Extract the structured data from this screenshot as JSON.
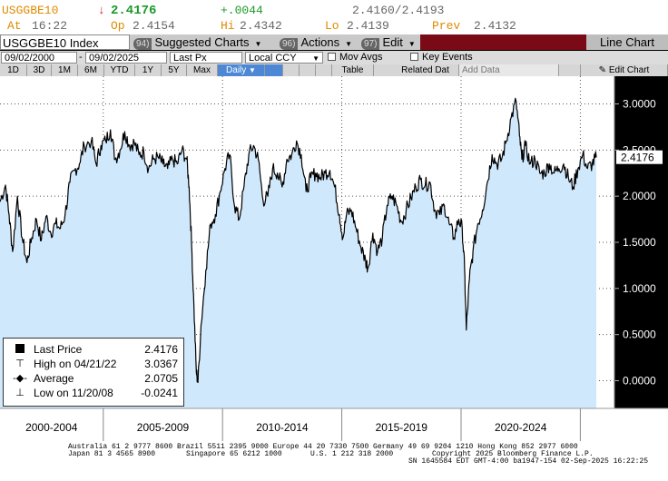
{
  "quote": {
    "ticker": "USGGBE10",
    "arrow": "↓",
    "last": "2.4176",
    "change": "+.0044",
    "bid_ask": "2.4160/2.4193",
    "at_label": "At",
    "at_value": "16:22",
    "open_label": "Op",
    "open_value": "2.4154",
    "high_label": "Hi",
    "high_value": "2.4342",
    "low_label": "Lo",
    "low_value": "2.4139",
    "prev_label": "Prev",
    "prev_value": "2.4132"
  },
  "toolbar": {
    "security": "USGGBE10 Index",
    "suggested_num": "94)",
    "suggested": "Suggested Charts",
    "actions_num": "96)",
    "actions": "Actions",
    "edit_num": "97)",
    "edit": "Edit",
    "chart_type": "Line Chart"
  },
  "controls": {
    "start_date": "09/02/2000",
    "end_date": "09/02/2025",
    "field": "Last Px",
    "currency": "Local CCY",
    "mov_avgs": "Mov Avgs",
    "key_events": "Key Events"
  },
  "periods": [
    "1D",
    "3D",
    "1M",
    "6M",
    "YTD",
    "1Y",
    "5Y",
    "Max"
  ],
  "frequency": "Daily",
  "actions2": {
    "table": "Table",
    "related": "Related Dat",
    "add_data": "Add Data",
    "edit_chart": "Edit Chart"
  },
  "chart_data": {
    "type": "area",
    "series": [
      {
        "name": "USGGBE10 Index"
      }
    ],
    "x_tick_labels": [
      "2000-2004",
      "2005-2009",
      "2010-2014",
      "2015-2019",
      "2020-2024"
    ],
    "y_ticks": [
      "3.0000",
      "2.5000",
      "2.0000",
      "1.5000",
      "1.0000",
      "0.5000",
      "0.0000"
    ],
    "ylim": [
      -0.3,
      3.3
    ],
    "last_value_label": "2.4176",
    "points": [
      [
        2000.67,
        1.94
      ],
      [
        2000.9,
        2.12
      ],
      [
        2001.05,
        1.8
      ],
      [
        2001.2,
        1.4
      ],
      [
        2001.4,
        2.0
      ],
      [
        2001.6,
        1.55
      ],
      [
        2001.8,
        1.28
      ],
      [
        2002.0,
        1.55
      ],
      [
        2002.2,
        1.75
      ],
      [
        2002.4,
        1.52
      ],
      [
        2002.6,
        1.78
      ],
      [
        2002.8,
        1.6
      ],
      [
        2003.0,
        1.7
      ],
      [
        2003.2,
        1.65
      ],
      [
        2003.4,
        1.8
      ],
      [
        2003.6,
        2.15
      ],
      [
        2003.8,
        2.28
      ],
      [
        2004.0,
        2.35
      ],
      [
        2004.2,
        2.55
      ],
      [
        2004.5,
        2.6
      ],
      [
        2004.7,
        2.35
      ],
      [
        2004.9,
        2.55
      ],
      [
        2005.1,
        2.6
      ],
      [
        2005.3,
        2.72
      ],
      [
        2005.5,
        2.4
      ],
      [
        2005.7,
        2.5
      ],
      [
        2005.9,
        2.7
      ],
      [
        2006.1,
        2.55
      ],
      [
        2006.3,
        2.58
      ],
      [
        2006.5,
        2.45
      ],
      [
        2006.7,
        2.48
      ],
      [
        2006.9,
        2.3
      ],
      [
        2007.1,
        2.4
      ],
      [
        2007.3,
        2.42
      ],
      [
        2007.5,
        2.35
      ],
      [
        2007.7,
        2.3
      ],
      [
        2007.9,
        2.4
      ],
      [
        2008.1,
        2.35
      ],
      [
        2008.3,
        2.5
      ],
      [
        2008.5,
        2.4
      ],
      [
        2008.6,
        2.1
      ],
      [
        2008.7,
        1.5
      ],
      [
        2008.8,
        0.8
      ],
      [
        2008.9,
        0.1
      ],
      [
        2008.97,
        -0.02
      ],
      [
        2009.1,
        0.6
      ],
      [
        2009.3,
        1.2
      ],
      [
        2009.5,
        1.7
      ],
      [
        2009.7,
        1.8
      ],
      [
        2009.9,
        2.05
      ],
      [
        2010.1,
        2.3
      ],
      [
        2010.3,
        2.45
      ],
      [
        2010.5,
        1.9
      ],
      [
        2010.7,
        1.75
      ],
      [
        2010.9,
        2.1
      ],
      [
        2011.1,
        2.45
      ],
      [
        2011.3,
        2.55
      ],
      [
        2011.5,
        2.4
      ],
      [
        2011.7,
        1.95
      ],
      [
        2011.9,
        2.0
      ],
      [
        2012.1,
        2.3
      ],
      [
        2012.3,
        2.25
      ],
      [
        2012.5,
        2.1
      ],
      [
        2012.7,
        2.4
      ],
      [
        2012.9,
        2.45
      ],
      [
        2013.1,
        2.6
      ],
      [
        2013.3,
        2.45
      ],
      [
        2013.5,
        2.05
      ],
      [
        2013.7,
        2.2
      ],
      [
        2013.9,
        2.25
      ],
      [
        2014.1,
        2.2
      ],
      [
        2014.3,
        2.25
      ],
      [
        2014.5,
        2.28
      ],
      [
        2014.7,
        2.1
      ],
      [
        2014.9,
        1.8
      ],
      [
        2015.05,
        1.55
      ],
      [
        2015.2,
        1.8
      ],
      [
        2015.4,
        1.85
      ],
      [
        2015.6,
        1.65
      ],
      [
        2015.8,
        1.45
      ],
      [
        2016.0,
        1.3
      ],
      [
        2016.1,
        1.22
      ],
      [
        2016.3,
        1.6
      ],
      [
        2016.5,
        1.4
      ],
      [
        2016.7,
        1.55
      ],
      [
        2016.9,
        1.9
      ],
      [
        2017.1,
        2.0
      ],
      [
        2017.3,
        1.9
      ],
      [
        2017.5,
        1.72
      ],
      [
        2017.7,
        1.85
      ],
      [
        2017.9,
        1.98
      ],
      [
        2018.1,
        2.1
      ],
      [
        2018.3,
        2.18
      ],
      [
        2018.5,
        2.12
      ],
      [
        2018.7,
        2.15
      ],
      [
        2018.9,
        1.85
      ],
      [
        2019.1,
        1.8
      ],
      [
        2019.3,
        1.9
      ],
      [
        2019.5,
        1.7
      ],
      [
        2019.7,
        1.55
      ],
      [
        2019.9,
        1.75
      ],
      [
        2020.05,
        1.65
      ],
      [
        2020.15,
        1.2
      ],
      [
        2020.22,
        0.55
      ],
      [
        2020.35,
        1.1
      ],
      [
        2020.5,
        1.4
      ],
      [
        2020.7,
        1.7
      ],
      [
        2020.9,
        1.85
      ],
      [
        2021.1,
        2.15
      ],
      [
        2021.3,
        2.45
      ],
      [
        2021.5,
        2.35
      ],
      [
        2021.7,
        2.4
      ],
      [
        2021.9,
        2.6
      ],
      [
        2022.1,
        2.85
      ],
      [
        2022.31,
        3.03
      ],
      [
        2022.45,
        2.65
      ],
      [
        2022.55,
        2.4
      ],
      [
        2022.7,
        2.55
      ],
      [
        2022.9,
        2.35
      ],
      [
        2023.1,
        2.4
      ],
      [
        2023.3,
        2.25
      ],
      [
        2023.5,
        2.25
      ],
      [
        2023.7,
        2.35
      ],
      [
        2023.9,
        2.25
      ],
      [
        2024.1,
        2.3
      ],
      [
        2024.3,
        2.35
      ],
      [
        2024.5,
        2.2
      ],
      [
        2024.7,
        2.1
      ],
      [
        2024.9,
        2.3
      ],
      [
        2025.1,
        2.45
      ],
      [
        2025.3,
        2.3
      ],
      [
        2025.5,
        2.35
      ],
      [
        2025.67,
        2.42
      ]
    ]
  },
  "legend": {
    "rows": [
      {
        "label": "Last Price",
        "value": "2.4176"
      },
      {
        "label": "High on 04/21/22",
        "value": "3.0367"
      },
      {
        "label": "Average",
        "value": "2.0705"
      },
      {
        "label": "Low on 11/20/08",
        "value": "-0.0241"
      }
    ]
  },
  "footer": {
    "line1": "Australia 61 2 9777 8600 Brazil 5511 2395 9000 Europe 44 20 7330 7500 Germany 49 69 9204 1210 Hong Kong 852 2977 6000",
    "line2": "Japan 81 3 4565 8900",
    "line2b": "Singapore 65 6212 1000",
    "line2c": "U.S. 1 212 318 2000",
    "line2d": "Copyright 2025 Bloomberg Finance L.P.",
    "line3": "SN 1645584 EDT  GMT-4:00 ba1947-154 02-Sep-2025 16:22:25"
  },
  "colors": {
    "area_fill": "#cfe8fb",
    "plot_bg": "#ffffff",
    "line": "#000000",
    "accent": "#7a0a16",
    "selected": "#4c88d6"
  }
}
